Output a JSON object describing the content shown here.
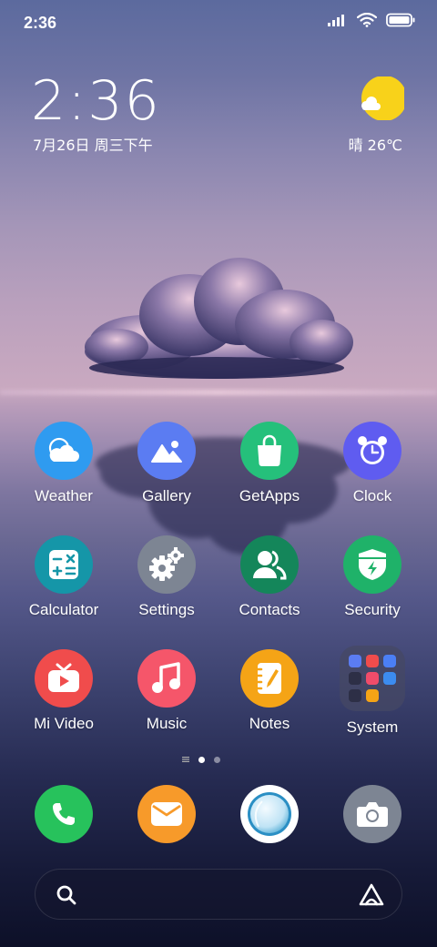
{
  "status_bar": {
    "time": "2:36"
  },
  "clock_widget": {
    "time": "2:36",
    "date": "7月26日 周三下午"
  },
  "weather_widget": {
    "condition": "晴",
    "temperature": "26℃",
    "condition_icon": "sunny-cloud-icon"
  },
  "apps": [
    {
      "label": "Weather",
      "icon": "weather-icon",
      "color": "#2f9bf0"
    },
    {
      "label": "Gallery",
      "icon": "gallery-icon",
      "color": "#5b7cf2"
    },
    {
      "label": "GetApps",
      "icon": "getapps-icon",
      "color": "#25c07b"
    },
    {
      "label": "Clock",
      "icon": "clock-icon",
      "color": "#5f5cf0"
    },
    {
      "label": "Calculator",
      "icon": "calculator-icon",
      "color": "#1596a8"
    },
    {
      "label": "Settings",
      "icon": "settings-icon",
      "color": "#7d8593"
    },
    {
      "label": "Contacts",
      "icon": "contacts-icon",
      "color": "#14865a"
    },
    {
      "label": "Security",
      "icon": "security-icon",
      "color": "#1fb269"
    },
    {
      "label": "Mi Video",
      "icon": "mi-video-icon",
      "color": "#f04c4c"
    },
    {
      "label": "Music",
      "icon": "music-icon",
      "color": "#f5566a"
    },
    {
      "label": "Notes",
      "icon": "notes-icon",
      "color": "#f5a416"
    },
    {
      "label": "System",
      "icon": "system-folder-icon",
      "color": "#464864"
    }
  ],
  "dock": [
    {
      "icon": "phone-icon",
      "color": "#27c25c"
    },
    {
      "icon": "messaging-icon",
      "color": "#f79a2a"
    },
    {
      "icon": "browser-icon",
      "color": "#ffffff"
    },
    {
      "icon": "camera-icon",
      "color": "#7d8593"
    }
  ],
  "page_indicator": {
    "pages": 3,
    "current": 2
  },
  "search_bar": {
    "left_icon": "search-icon",
    "right_icon": "app-vault-icon"
  }
}
